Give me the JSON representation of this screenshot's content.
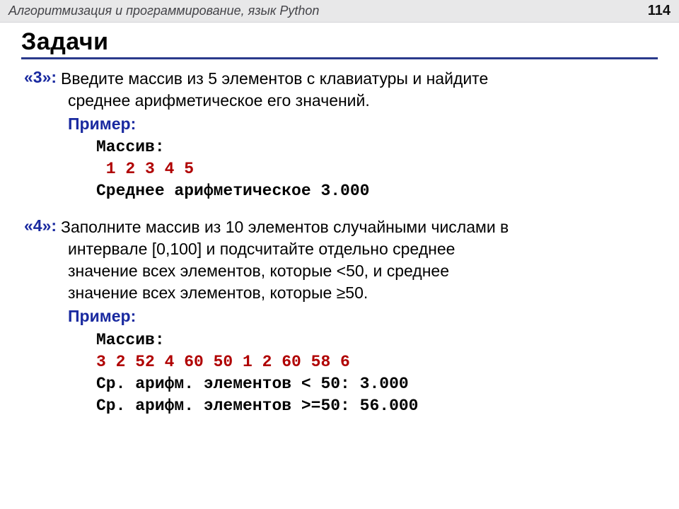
{
  "header": {
    "subject": "Алгоритмизация и программирование, язык Python",
    "page": "114"
  },
  "title": "Задачи",
  "task3": {
    "grade": "«3»:",
    "desc_line1": "Введите массив из 5 элементов с клавиатуры и найдите",
    "desc_line2": "среднее арифметическое его значений.",
    "example_label": "Пример:",
    "arr_label": "Массив:",
    "arr_values": " 1 2 3 4 5",
    "result": "Среднее арифметическое 3.000"
  },
  "task4": {
    "grade": "«4»:",
    "desc_line1": "Заполните массив из 10 элементов случайными числами в",
    "desc_line2": "интервале [0,100] и подсчитайте отдельно среднее",
    "desc_line3": "значение всех элементов, которые <50, и среднее",
    "desc_line4": "значение всех элементов, которые ≥50.",
    "example_label": "Пример:",
    "arr_label": "Массив:",
    "arr_values": "3 2 52 4 60 50 1 2 60 58 6",
    "result1": "Ср. арифм. элементов < 50: 3.000",
    "result2": "Ср. арифм. элементов >=50: 56.000"
  }
}
